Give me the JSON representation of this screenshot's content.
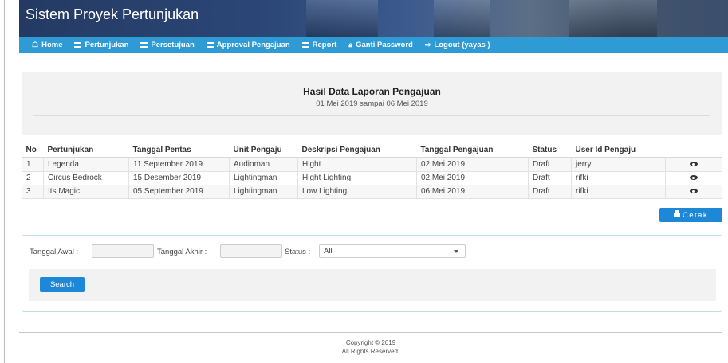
{
  "app": {
    "title": "Sistem Proyek Pertunjukan"
  },
  "nav": [
    {
      "label": "Home",
      "icon": "home-icon"
    },
    {
      "label": "Pertunjukan",
      "icon": "bars-icon"
    },
    {
      "label": "Persetujuan",
      "icon": "bars-icon"
    },
    {
      "label": "Approval Pengajuan",
      "icon": "bars-icon"
    },
    {
      "label": "Report",
      "icon": "bars-icon"
    },
    {
      "label": "Ganti Password",
      "icon": "lock-icon"
    },
    {
      "label": "Logout (yayas )",
      "icon": "logout-icon"
    }
  ],
  "report": {
    "title": "Hasil Data Laporan Pengajuan",
    "subtitle": "01 Mei 2019 sampai 06 Mei 2019"
  },
  "table": {
    "headers": [
      "No",
      "Pertunjukan",
      "Tanggal Pentas",
      "Unit Pengaju",
      "Deskripsi Pengajuan",
      "Tanggal Pengajuan",
      "Status",
      "User Id Pengaju",
      ""
    ],
    "rows": [
      [
        "1",
        "Legenda",
        "11 September 2019",
        "Audioman",
        "Hight",
        "02 Mei 2019",
        "Draft",
        "jerry"
      ],
      [
        "2",
        "Circus Bedrock",
        "15 Desember 2019",
        "Lightingman",
        "Hight Lighting",
        "02 Mei 2019",
        "Draft",
        "rifki"
      ],
      [
        "3",
        "Its Magic",
        "05 September 2019",
        "Lightingman",
        "Low Lighting",
        "06 Mei 2019",
        "Draft",
        "rifki"
      ]
    ]
  },
  "cetak_label": "Cetak",
  "filter": {
    "tanggal_awal_label": "Tanggal Awal :",
    "tanggal_awal_value": "",
    "tanggal_akhir_label": "Tanggal Akhir :",
    "tanggal_akhir_value": "",
    "status_label": "Status :",
    "status_value": "All",
    "search_label": "Search"
  },
  "footer": {
    "copyright": "Copyright © 2019",
    "rights": "All Rights Reserved."
  },
  "colors": {
    "nav_bg": "#2f9bd4",
    "button_bg": "#1e88d8",
    "header_bg": "#2b4777"
  }
}
